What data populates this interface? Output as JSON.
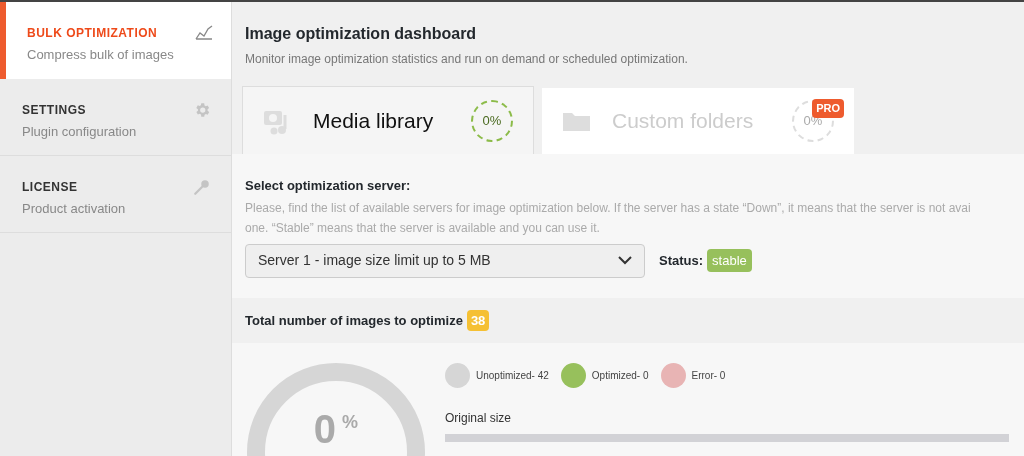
{
  "sidebar": {
    "items": [
      {
        "title": "BULK OPTIMIZATION",
        "subtitle": "Compress bulk of images",
        "kind": "chart",
        "selected": true
      },
      {
        "title": "SETTINGS",
        "subtitle": "Plugin configuration",
        "kind": "gear",
        "selected": false
      },
      {
        "title": "LICENSE",
        "subtitle": "Product activation",
        "kind": "key",
        "selected": false
      }
    ]
  },
  "header": {
    "title": "Image optimization dashboard",
    "subtitle": "Monitor image optimization statistics and run on demand or scheduled optimization."
  },
  "tabs": [
    {
      "label": "Media library",
      "kind": "media",
      "percent": "0%",
      "selected": true
    },
    {
      "label": "Custom folders",
      "kind": "folder",
      "percent": "0%",
      "badge": "PRO",
      "selected": false
    }
  ],
  "server": {
    "heading": "Select optimization server:",
    "description_lines": [
      "Please, find the list of available servers for image optimization below. If the server has a state “Down”, it means that the server is not avai",
      "one. “Stable” means that the server is available and you can use it."
    ],
    "value": "Server 1 - image size limit up to 5 MB",
    "status_label": "Status:",
    "status": "stable"
  },
  "total": {
    "label": "Total number of images to optimize",
    "count": "38"
  },
  "summary": {
    "percent_value": "0",
    "percent_sign": "%",
    "legend": [
      {
        "label": "Unoptimized- 42",
        "color": "#d6d6d6"
      },
      {
        "label": "Optimized- 0",
        "color": "#97c05c"
      },
      {
        "label": "Error- 0",
        "color": "#e8b4b4"
      }
    ],
    "original_size_label": "Original size"
  }
}
